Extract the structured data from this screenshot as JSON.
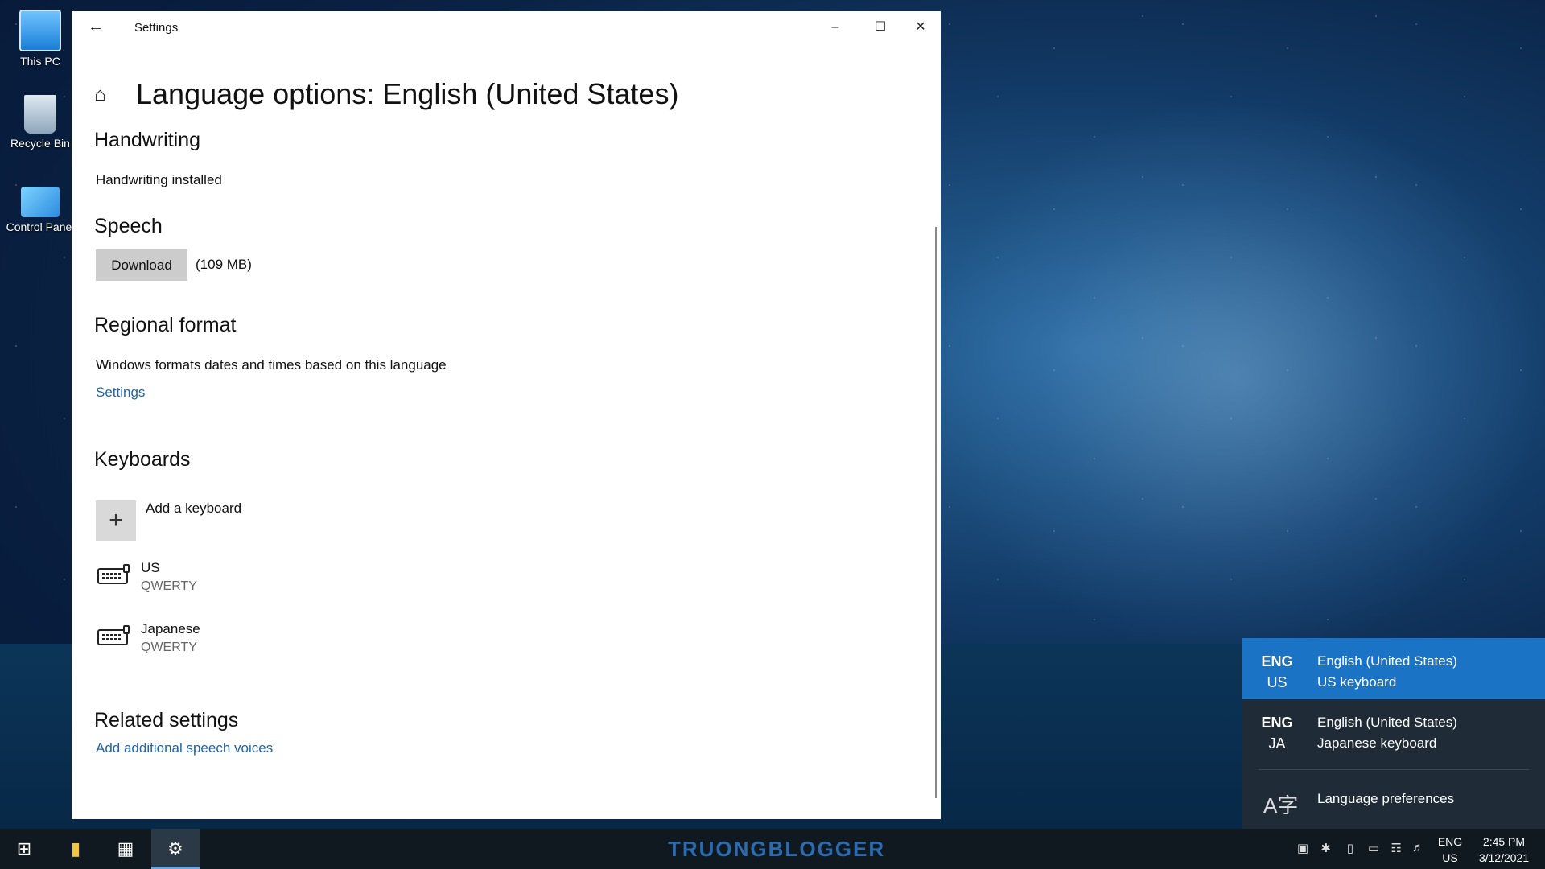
{
  "desktop": {
    "icons": [
      {
        "label": "This PC"
      },
      {
        "label": "Recycle Bin"
      },
      {
        "label": "Control Panel"
      }
    ]
  },
  "window": {
    "title": "Settings",
    "back_icon": "back-arrow-icon",
    "controls": [
      "minimize-icon",
      "maximize-icon",
      "close-icon"
    ]
  },
  "page": {
    "title": "Language options: English (United States)",
    "handwriting": {
      "heading": "Handwriting",
      "status": "Handwriting installed"
    },
    "speech": {
      "heading": "Speech",
      "download_label": "Download",
      "size": "(109 MB)"
    },
    "regional": {
      "heading": "Regional format",
      "description": "Windows formats dates and times based on this language",
      "settings_link": "Settings"
    },
    "keyboards": {
      "heading": "Keyboards",
      "add_label": "Add a keyboard",
      "items": [
        {
          "name": "US",
          "layout": "QWERTY"
        },
        {
          "name": "Japanese",
          "layout": "QWERTY"
        }
      ]
    },
    "related": {
      "heading": "Related settings",
      "link": "Add additional speech voices"
    }
  },
  "flyout": {
    "items": [
      {
        "code1": "ENG",
        "code2": "US",
        "line1": "English (United States)",
        "line2": "US keyboard",
        "active": true
      },
      {
        "code1": "ENG",
        "code2": "JA",
        "line1": "English (United States)",
        "line2": "Japanese keyboard",
        "active": false
      }
    ],
    "preferences": "Language preferences"
  },
  "taskbar": {
    "watermark": "TRUONGBLOGGER",
    "lang_line1": "ENG",
    "lang_line2": "US",
    "time": "2:45 PM",
    "date": "3/12/2021"
  },
  "colors": {
    "accent": "#1a73c4",
    "link": "#1f64a8",
    "taskbar": "#101820"
  }
}
